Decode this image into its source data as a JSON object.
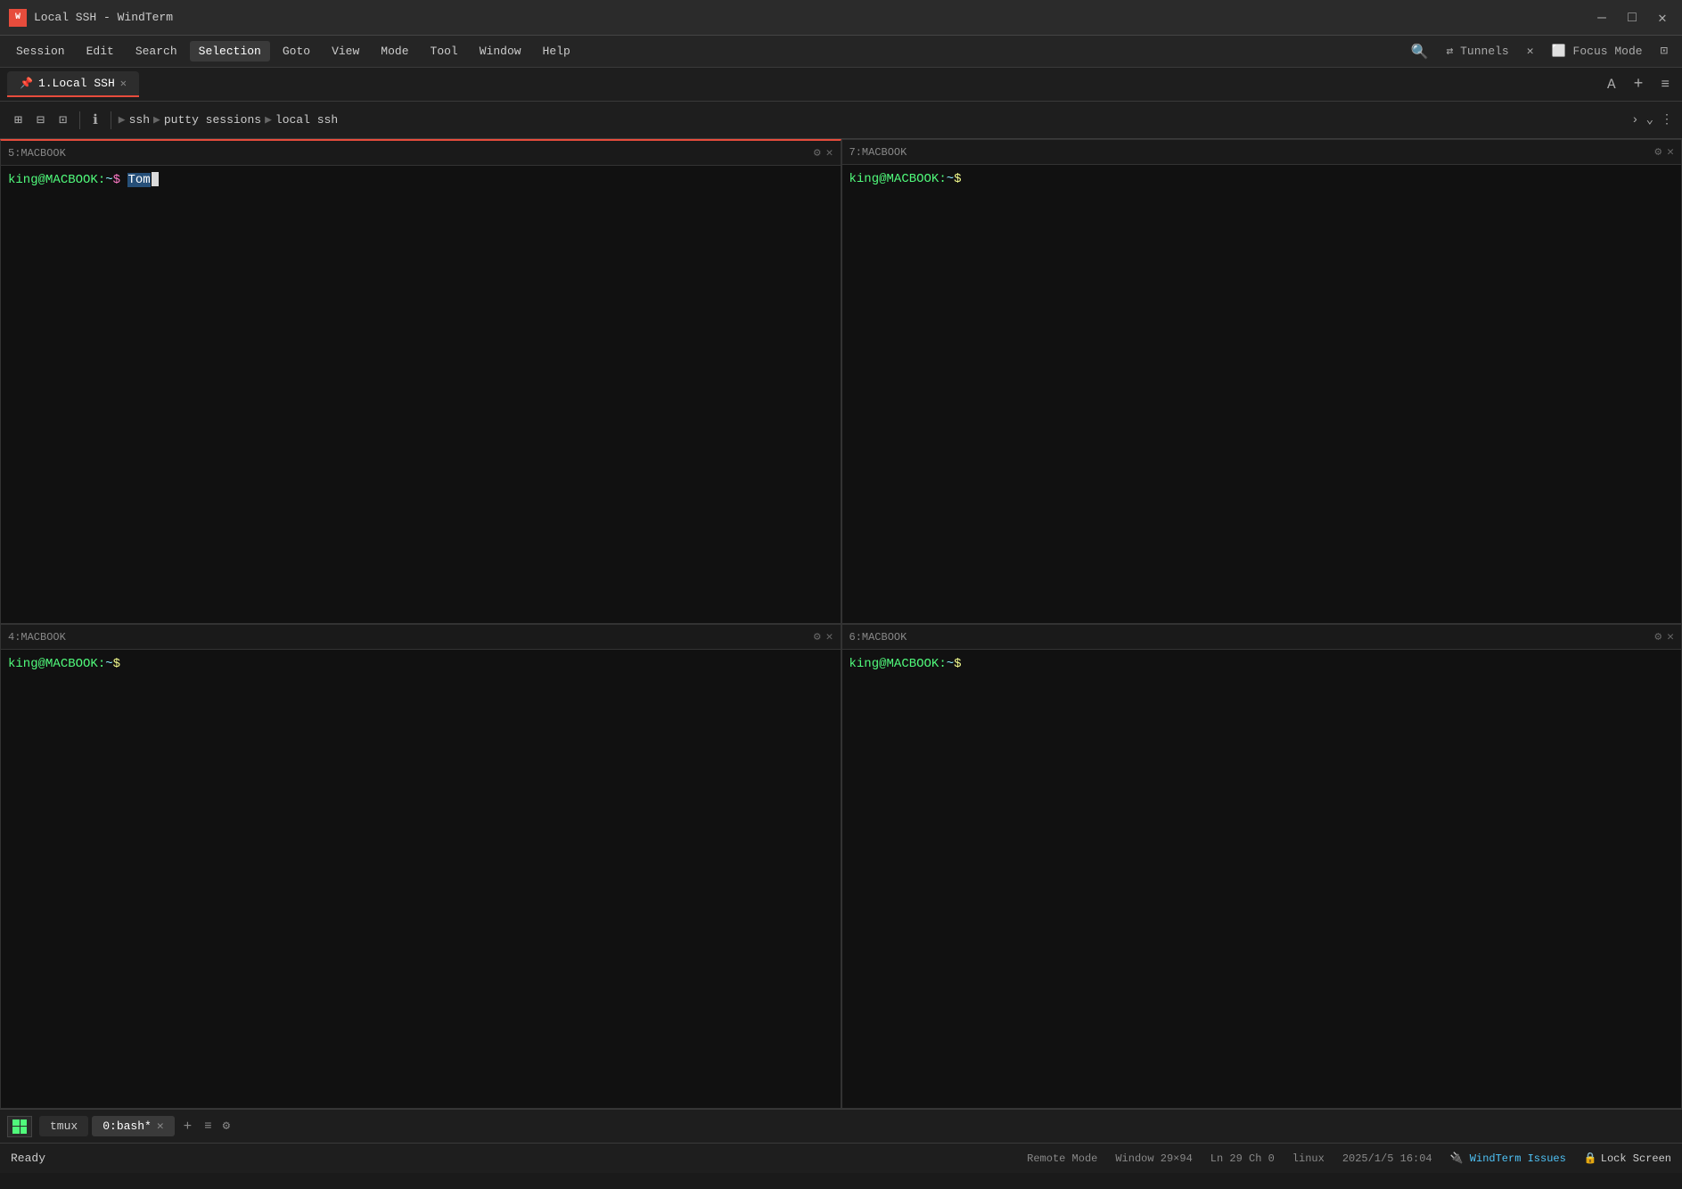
{
  "titleBar": {
    "title": "Local SSH - WindTerm",
    "icon": "W",
    "controls": {
      "minimize": "—",
      "maximize": "□",
      "close": "✕"
    }
  },
  "menuBar": {
    "items": [
      {
        "label": "Session",
        "active": false
      },
      {
        "label": "Edit",
        "active": false
      },
      {
        "label": "Search",
        "active": false
      },
      {
        "label": "Selection",
        "active": true
      },
      {
        "label": "Goto",
        "active": false
      },
      {
        "label": "View",
        "active": false
      },
      {
        "label": "Mode",
        "active": false
      },
      {
        "label": "Tool",
        "active": false
      },
      {
        "label": "Window",
        "active": false
      },
      {
        "label": "Help",
        "active": false
      }
    ],
    "tunnels": "Tunnels",
    "focusMode": "Focus Mode"
  },
  "tabBar": {
    "tabs": [
      {
        "label": "1.Local SSH",
        "active": true,
        "closable": true,
        "pinned": true
      }
    ],
    "controls": {
      "fontSizeUp": "A",
      "add": "+",
      "menu": "≡"
    }
  },
  "toolbar": {
    "buttons": [
      "⊞",
      "⊟",
      "⊡"
    ],
    "infoBtn": "ℹ",
    "breadcrumb": [
      {
        "label": "ssh"
      },
      {
        "label": "putty sessions"
      },
      {
        "label": "local ssh"
      }
    ],
    "rightControls": {
      "chevronRight": "›",
      "chevronDown": "⌄",
      "menu": "⋮"
    }
  },
  "panes": [
    {
      "id": "pane-5",
      "title": "5:MACBOOK",
      "prompt": "king@MACBOOK:~$",
      "user": "king",
      "host": "MACBOOK",
      "tilde": "~",
      "dollar": "$",
      "command": "Tom",
      "hasSelection": true,
      "hasCursor": true,
      "position": "top-left"
    },
    {
      "id": "pane-7",
      "title": "7:MACBOOK",
      "prompt": "king@MACBOOK:~$",
      "user": "king",
      "host": "MACBOOK",
      "tilde": "~",
      "dollar": "$",
      "command": "",
      "hasSelection": false,
      "hasCursor": false,
      "position": "top-right"
    },
    {
      "id": "pane-4",
      "title": "4:MACBOOK",
      "prompt": "king@MACBOOK:~$",
      "user": "king",
      "host": "MACBOOK",
      "tilde": "~",
      "dollar": "$",
      "command": "",
      "hasSelection": false,
      "hasCursor": false,
      "position": "bottom-left"
    },
    {
      "id": "pane-6",
      "title": "6:MACBOOK",
      "prompt": "king@MACBOOK:~$",
      "user": "king",
      "host": "MACBOOK",
      "tilde": "~",
      "dollar": "$",
      "command": "",
      "hasSelection": false,
      "hasCursor": false,
      "position": "bottom-right"
    }
  ],
  "bottomTabBar": {
    "tabs": [
      {
        "label": "tmux",
        "active": false,
        "icon": true
      },
      {
        "label": "0:bash*",
        "active": true,
        "closable": true
      }
    ],
    "add": "+",
    "list": "≡",
    "settings": "⚙"
  },
  "statusBar": {
    "ready": "Ready",
    "remoteMode": "Remote Mode",
    "windowSize": "Window 29×94",
    "cursorPos": "Ln 29 Ch 0",
    "os": "linux",
    "datetime": "2025/1/5 16:04",
    "windtermIssues": "WindTerm Issues",
    "lockScreen": "Lock Screen"
  }
}
